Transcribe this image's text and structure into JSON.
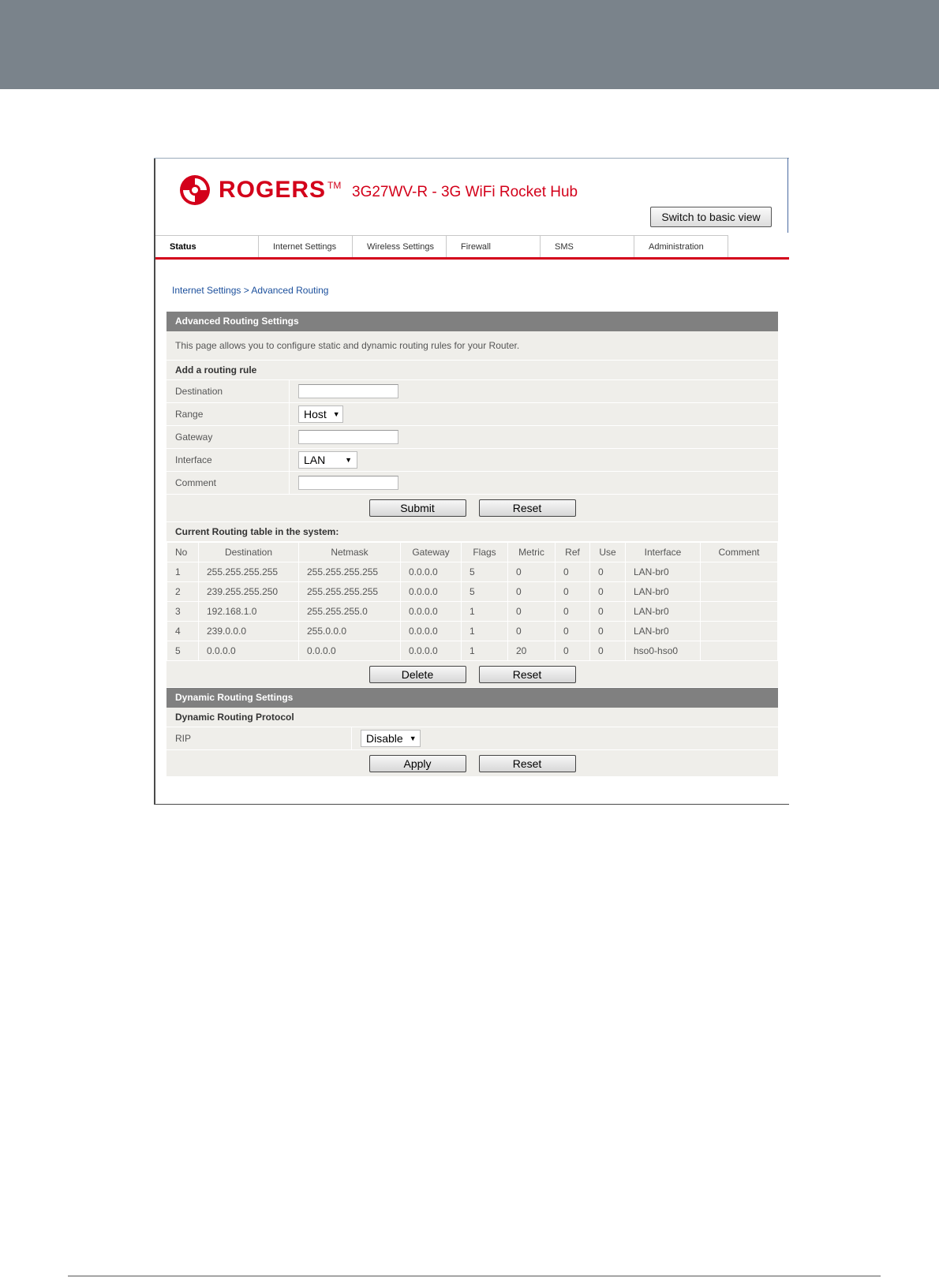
{
  "header": {
    "brand": "ROGERS",
    "trademark": "TM",
    "product_title": "3G27WV-R - 3G WiFi Rocket Hub",
    "switch_view_label": "Switch to basic view"
  },
  "nav": {
    "tabs": [
      {
        "label": "Status"
      },
      {
        "label": "Internet Settings"
      },
      {
        "label": "Wireless Settings"
      },
      {
        "label": "Firewall"
      },
      {
        "label": "SMS"
      },
      {
        "label": "Administration"
      }
    ]
  },
  "breadcrumb": "Internet Settings > Advanced Routing",
  "advanced": {
    "title": "Advanced Routing Settings",
    "description": "This page allows you to configure static and dynamic routing rules for your Router.",
    "add_rule_title": "Add a routing rule",
    "fields": {
      "destination_label": "Destination",
      "destination_value": "",
      "range_label": "Range",
      "range_value": "Host",
      "gateway_label": "Gateway",
      "gateway_value": "",
      "interface_label": "Interface",
      "interface_value": "LAN",
      "comment_label": "Comment",
      "comment_value": ""
    },
    "submit_label": "Submit",
    "reset_label": "Reset"
  },
  "routing_table": {
    "title": "Current Routing table in the system:",
    "columns": [
      "No",
      "Destination",
      "Netmask",
      "Gateway",
      "Flags",
      "Metric",
      "Ref",
      "Use",
      "Interface",
      "Comment"
    ],
    "rows": [
      [
        "1",
        "255.255.255.255",
        "255.255.255.255",
        "0.0.0.0",
        "5",
        "0",
        "0",
        "0",
        "LAN-br0",
        ""
      ],
      [
        "2",
        "239.255.255.250",
        "255.255.255.255",
        "0.0.0.0",
        "5",
        "0",
        "0",
        "0",
        "LAN-br0",
        ""
      ],
      [
        "3",
        "192.168.1.0",
        "255.255.255.0",
        "0.0.0.0",
        "1",
        "0",
        "0",
        "0",
        "LAN-br0",
        ""
      ],
      [
        "4",
        "239.0.0.0",
        "255.0.0.0",
        "0.0.0.0",
        "1",
        "0",
        "0",
        "0",
        "LAN-br0",
        ""
      ],
      [
        "5",
        "0.0.0.0",
        "0.0.0.0",
        "0.0.0.0",
        "1",
        "20",
        "0",
        "0",
        "hso0-hso0",
        ""
      ]
    ],
    "delete_label": "Delete",
    "reset_label": "Reset"
  },
  "dynamic": {
    "title": "Dynamic Routing Settings",
    "protocol_title": "Dynamic Routing Protocol",
    "rip_label": "RIP",
    "rip_value": "Disable",
    "apply_label": "Apply",
    "reset_label": "Reset"
  },
  "colors": {
    "brand_red": "#d3001a",
    "section_header": "#808080",
    "row_bg": "#efeeea",
    "top_band": "#7a838b"
  }
}
